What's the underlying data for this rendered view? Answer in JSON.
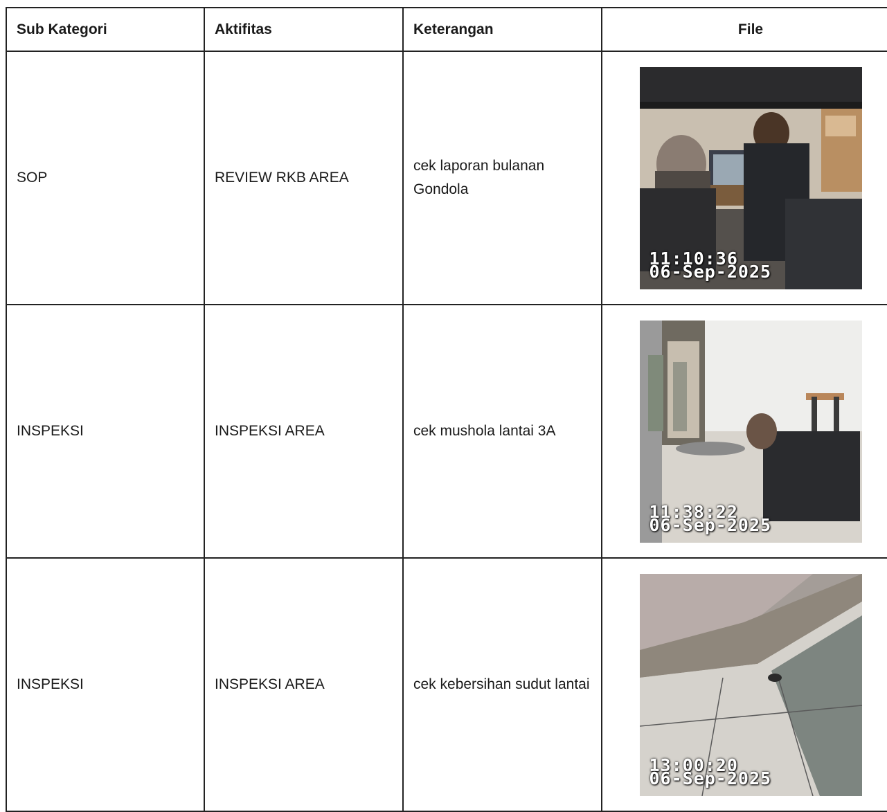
{
  "table": {
    "headers": {
      "sub_kategori": "Sub Kategori",
      "aktifitas": "Aktifitas",
      "keterangan": "Keterangan",
      "file": "File"
    },
    "rows": [
      {
        "sub_kategori": "SOP",
        "aktifitas": "REVIEW RKB AREA",
        "keterangan": "cek laporan bulanan Gondola",
        "file": {
          "time": "11:10:36",
          "date": "06-Sep-2025"
        }
      },
      {
        "sub_kategori": "INSPEKSI",
        "aktifitas": "INSPEKSI AREA",
        "keterangan": "cek mushola lantai 3A",
        "file": {
          "time": "11:38:22",
          "date": "06-Sep-2025"
        }
      },
      {
        "sub_kategori": "INSPEKSI",
        "aktifitas": "INSPEKSI AREA",
        "keterangan": "cek kebersihan sudut lantai",
        "file": {
          "time": "13:00:20",
          "date": "06-Sep-2025"
        }
      }
    ]
  }
}
